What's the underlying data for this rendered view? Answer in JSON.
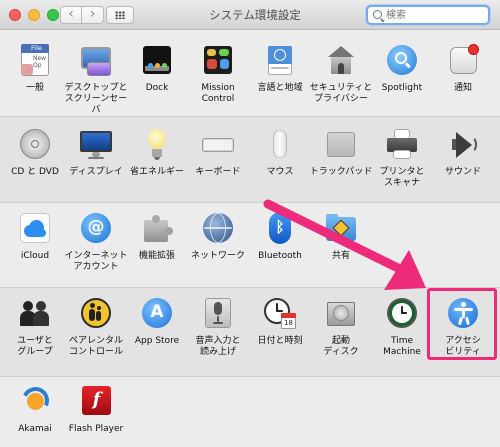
{
  "window": {
    "title": "システム環境設定",
    "back": "‹",
    "forward": "›"
  },
  "search": {
    "placeholder": "検索"
  },
  "sections": [
    [
      {
        "id": "general",
        "label": "一般",
        "icon": "general-icon",
        "file_badge": "File",
        "file_lines": "New\nOp"
      },
      {
        "id": "desktop",
        "label": "デスクトップと\nスクリーンセーバ",
        "icon": "desktop-screensaver-icon"
      },
      {
        "id": "dock",
        "label": "Dock",
        "icon": "dock-icon"
      },
      {
        "id": "mission",
        "label": "Mission\nControl",
        "icon": "mission-control-icon"
      },
      {
        "id": "language",
        "label": "言語と地域",
        "icon": "language-region-icon"
      },
      {
        "id": "security",
        "label": "セキュリティと\nプライバシー",
        "icon": "security-privacy-icon"
      },
      {
        "id": "spotlight",
        "label": "Spotlight",
        "icon": "spotlight-icon"
      },
      {
        "id": "notifications",
        "label": "通知",
        "icon": "notifications-icon"
      }
    ],
    [
      {
        "id": "cddvd",
        "label": "CD と DVD",
        "icon": "cd-dvd-icon"
      },
      {
        "id": "displays",
        "label": "ディスプレイ",
        "icon": "displays-icon"
      },
      {
        "id": "energy",
        "label": "省エネルギー",
        "icon": "energy-saver-icon"
      },
      {
        "id": "keyboard",
        "label": "キーボード",
        "icon": "keyboard-icon"
      },
      {
        "id": "mouse",
        "label": "マウス",
        "icon": "mouse-icon"
      },
      {
        "id": "trackpad",
        "label": "トラックパッド",
        "icon": "trackpad-icon"
      },
      {
        "id": "printers",
        "label": "プリンタと\nスキャナ",
        "icon": "printer-scanner-icon"
      },
      {
        "id": "sound",
        "label": "サウンド",
        "icon": "sound-icon"
      }
    ],
    [
      {
        "id": "icloud",
        "label": "iCloud",
        "icon": "icloud-icon"
      },
      {
        "id": "internet",
        "label": "インターネット\nアカウント",
        "icon": "internet-accounts-icon"
      },
      {
        "id": "extensions",
        "label": "機能拡張",
        "icon": "extensions-icon"
      },
      {
        "id": "network",
        "label": "ネットワーク",
        "icon": "network-icon"
      },
      {
        "id": "bluetooth",
        "label": "Bluetooth",
        "icon": "bluetooth-icon"
      },
      {
        "id": "sharing",
        "label": "共有",
        "icon": "sharing-icon"
      }
    ],
    [
      {
        "id": "users",
        "label": "ユーザと\nグループ",
        "icon": "users-groups-icon"
      },
      {
        "id": "parental",
        "label": "ペアレンタル\nコントロール",
        "icon": "parental-controls-icon"
      },
      {
        "id": "appstore",
        "label": "App Store",
        "icon": "app-store-icon"
      },
      {
        "id": "dictation",
        "label": "音声入力と\n読み上げ",
        "icon": "dictation-speech-icon"
      },
      {
        "id": "datetime",
        "label": "日付と時刻",
        "icon": "date-time-icon",
        "calendar_day": "18"
      },
      {
        "id": "startup",
        "label": "起動\nディスク",
        "icon": "startup-disk-icon"
      },
      {
        "id": "timemachine",
        "label": "Time\nMachine",
        "icon": "time-machine-icon"
      },
      {
        "id": "accessibility",
        "label": "アクセシ\nビリティ",
        "icon": "accessibility-icon"
      }
    ],
    [
      {
        "id": "akamai",
        "label": "Akamai",
        "icon": "akamai-icon"
      },
      {
        "id": "flash",
        "label": "Flash Player",
        "icon": "flash-player-icon"
      }
    ]
  ],
  "annotation": {
    "highlight_color": "#ee2a7b",
    "target": "accessibility"
  }
}
